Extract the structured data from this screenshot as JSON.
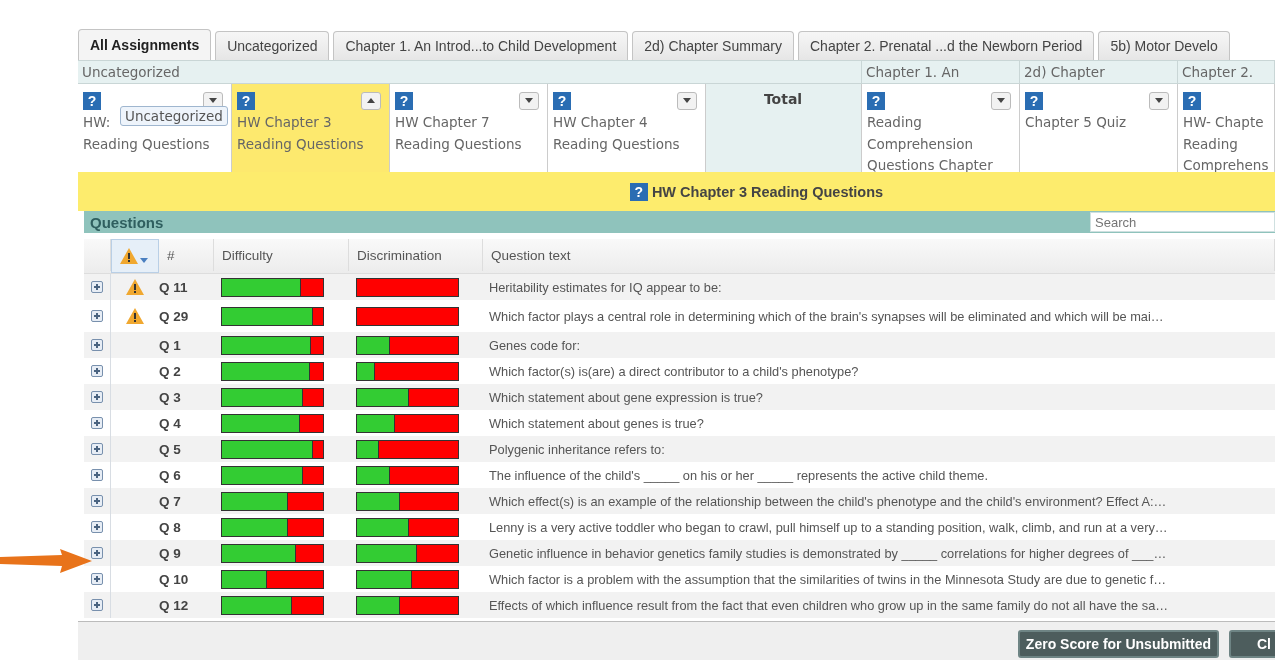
{
  "tabs": [
    {
      "label": "All Assignments",
      "selected": true
    },
    {
      "label": "Uncategorized",
      "selected": false
    },
    {
      "label": "Chapter 1. An Introd...to Child Development",
      "selected": false
    },
    {
      "label": "2d) Chapter Summary",
      "selected": false
    },
    {
      "label": "Chapter 2. Prenatal ...d the Newborn Period",
      "selected": false
    },
    {
      "label": "5b) Motor Develo",
      "selected": false
    }
  ],
  "categories": [
    {
      "label": "Uncategorized"
    },
    {
      "label": "Chapter 1. An"
    },
    {
      "label": "2d) Chapter"
    },
    {
      "label": "Chapter 2."
    }
  ],
  "assignments": [
    {
      "kind": "assignment",
      "help": "?",
      "title": [
        "HW:",
        "Reading Questions"
      ],
      "selected": false,
      "expanded": false
    },
    {
      "kind": "assignment",
      "help": "?",
      "title": [
        "HW Chapter 3",
        "Reading Questions"
      ],
      "selected": true,
      "expanded": true
    },
    {
      "kind": "assignment",
      "help": "?",
      "title": [
        "HW Chapter 7",
        "Reading Questions"
      ],
      "selected": false,
      "expanded": false
    },
    {
      "kind": "assignment",
      "help": "?",
      "title": [
        "HW Chapter 4",
        "Reading Questions"
      ],
      "selected": false,
      "expanded": false
    },
    {
      "kind": "total",
      "title": [
        "Total"
      ]
    },
    {
      "kind": "assignment",
      "help": "?",
      "title": [
        "Reading",
        "Comprehension",
        "Questions Chapter"
      ],
      "selected": false,
      "expanded": false
    },
    {
      "kind": "assignment",
      "help": "?",
      "title": [
        "Chapter 5 Quiz"
      ],
      "selected": false,
      "expanded": false
    },
    {
      "kind": "assignment",
      "help": "?",
      "title": [
        "HW- Chapte",
        "Reading",
        "Comprehens"
      ],
      "selected": false
    }
  ],
  "tooltip": "Uncategorized",
  "banner": {
    "help": "?",
    "title": "HW Chapter 3 Reading Questions"
  },
  "panel": {
    "title": "Questions",
    "search_placeholder": "Search"
  },
  "table": {
    "columns": [
      "#",
      "Difficulty",
      "Discrimination",
      "Question text"
    ],
    "rows": [
      {
        "flag": true,
        "number": "Q 11",
        "difficulty": {
          "level": 0.78
        },
        "discrimination": {
          "level": 0
        },
        "text": "Heritability estimates for IQ appear to be:"
      },
      {
        "flag": true,
        "number": "Q 29",
        "difficulty": {
          "level": 0.9
        },
        "discrimination": {
          "level": 0
        },
        "text": "Which factor plays a central role in determining which of the brain's synapses will be eliminated and which will be mai…"
      },
      {
        "flag": false,
        "number": "Q 1",
        "difficulty": {
          "level": 0.88
        },
        "discrimination": {
          "level": 0.33
        },
        "text": "Genes code for:"
      },
      {
        "flag": false,
        "number": "Q 2",
        "difficulty": {
          "level": 0.87
        },
        "discrimination": {
          "level": 0.18
        },
        "text": "Which factor(s) is(are) a direct contributor to a child's phenotype?"
      },
      {
        "flag": false,
        "number": "Q 3",
        "difficulty": {
          "level": 0.8
        },
        "discrimination": {
          "level": 0.51
        },
        "text": "Which statement about gene expression is true?"
      },
      {
        "flag": false,
        "number": "Q 4",
        "difficulty": {
          "level": 0.77
        },
        "discrimination": {
          "level": 0.38
        },
        "text": "Which statement about genes is true?"
      },
      {
        "flag": false,
        "number": "Q 5",
        "difficulty": {
          "level": 0.9
        },
        "discrimination": {
          "level": 0.22
        },
        "text": "Polygenic inheritance refers to:"
      },
      {
        "flag": false,
        "number": "Q 6",
        "difficulty": {
          "level": 0.8
        },
        "discrimination": {
          "level": 0.33
        },
        "text": "The influence of the child's _____ on his or her _____ represents the active child theme."
      },
      {
        "flag": false,
        "number": "Q 7",
        "difficulty": {
          "level": 0.65
        },
        "discrimination": {
          "level": 0.43
        },
        "text": "Which effect(s) is an example of the relationship between the child's phenotype and the child's environment? Effect A:…"
      },
      {
        "flag": false,
        "number": "Q 8",
        "difficulty": {
          "level": 0.65
        },
        "discrimination": {
          "level": 0.51
        },
        "text": "Lenny is a very active toddler who began to crawl, pull himself up to a standing position, walk, climb, and run at a very…"
      },
      {
        "flag": false,
        "number": "Q 9",
        "difficulty": {
          "level": 0.73
        },
        "discrimination": {
          "level": 0.59
        },
        "text": "Genetic influence in behavior genetics family studies is demonstrated by _____ correlations for higher degrees of ___…"
      },
      {
        "flag": false,
        "number": "Q 10",
        "difficulty": {
          "level": 0.45
        },
        "discrimination": {
          "level": 0.54
        },
        "text": "Which factor is a problem with the assumption that the similarities of twins in the Minnesota Study are due to genetic f…"
      },
      {
        "flag": false,
        "number": "Q 12",
        "difficulty": {
          "level": 0.69
        },
        "discrimination": {
          "level": 0.43
        },
        "text": "Effects of which influence result from the fact that even children who grow up in the same family do not all have the sa…"
      }
    ]
  },
  "footer": {
    "buttons": [
      "Zero Score for Unsubmitted",
      "Cl"
    ]
  }
}
